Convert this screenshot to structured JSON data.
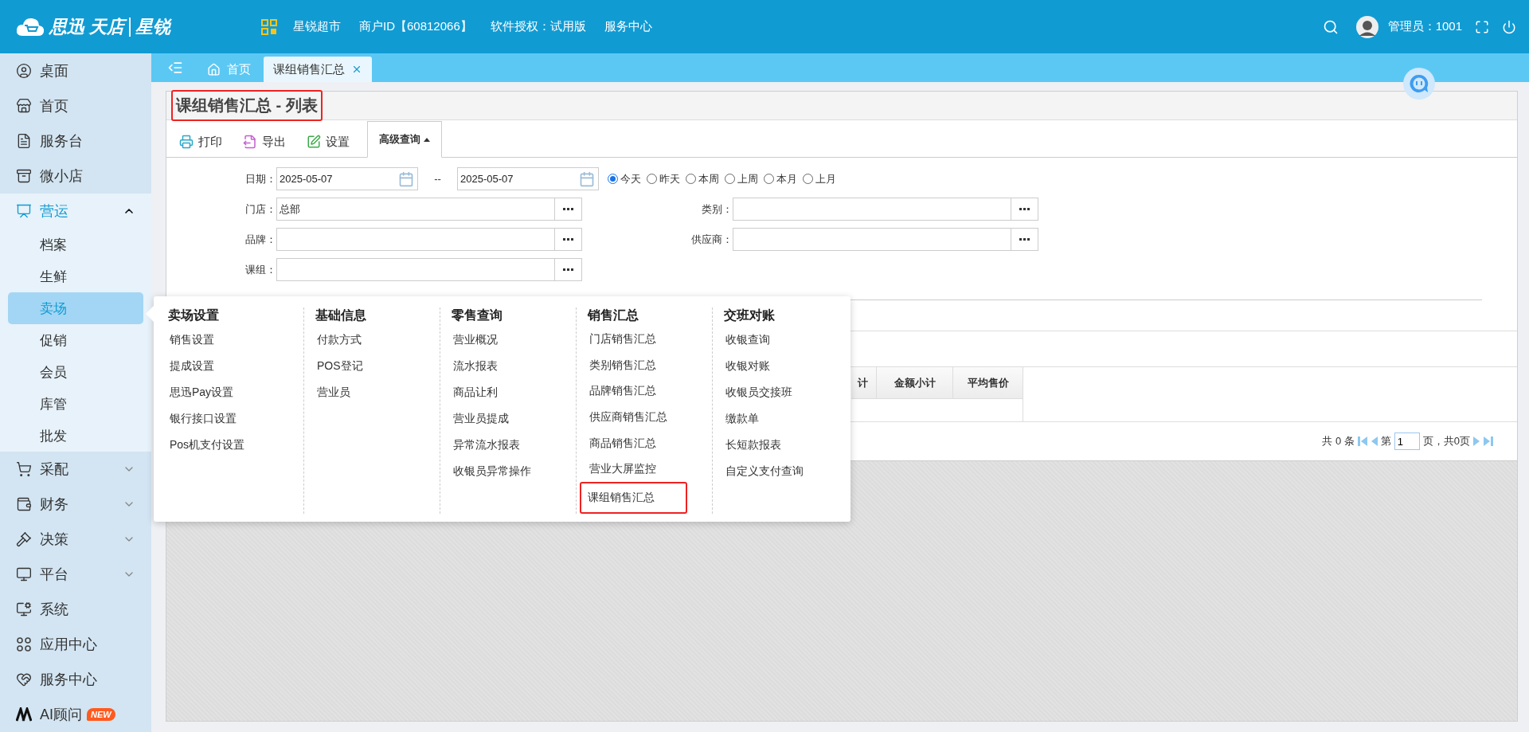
{
  "header": {
    "logo": {
      "brand": "思迅",
      "product": "天店",
      "edition": "星锐"
    },
    "nav": [
      "星锐超市",
      "商户ID【60812066】",
      "软件授权：试用版",
      "服务中心"
    ],
    "user": "管理员：1001"
  },
  "sidebar": {
    "items": [
      {
        "label": "桌面",
        "kind": "plain"
      },
      {
        "label": "首页",
        "kind": "plain"
      },
      {
        "label": "服务台",
        "kind": "plain"
      },
      {
        "label": "微小店",
        "kind": "plain"
      },
      {
        "label": "营运",
        "kind": "group",
        "expanded": true,
        "children": [
          {
            "label": "档案",
            "selected": false
          },
          {
            "label": "生鲜",
            "selected": false
          },
          {
            "label": "卖场",
            "selected": true
          },
          {
            "label": "促销",
            "selected": false
          },
          {
            "label": "会员",
            "selected": false
          },
          {
            "label": "库管",
            "selected": false
          },
          {
            "label": "批发",
            "selected": false
          }
        ]
      },
      {
        "label": "采配",
        "kind": "group",
        "expanded": false
      },
      {
        "label": "财务",
        "kind": "group",
        "expanded": false
      },
      {
        "label": "决策",
        "kind": "group",
        "expanded": false
      },
      {
        "label": "平台",
        "kind": "group",
        "expanded": false
      },
      {
        "label": "系统",
        "kind": "plain"
      },
      {
        "label": "应用中心",
        "kind": "plain"
      },
      {
        "label": "服务中心",
        "kind": "plain"
      },
      {
        "label": "AI顾问",
        "kind": "plain",
        "badge": "NEW"
      }
    ]
  },
  "tabs": [
    {
      "label": "首页",
      "selected": false,
      "closable": false
    },
    {
      "label": "课组销售汇总",
      "selected": true,
      "closable": true
    }
  ],
  "page": {
    "title": "课组销售汇总 - 列表",
    "title_highlighted": true,
    "toolbar": [
      "打印",
      "导出",
      "设置"
    ],
    "query_tab": {
      "label": "高级查询",
      "expanded": true
    },
    "date": {
      "label": "日期：",
      "from": "2025-05-07",
      "separator": "--",
      "to": "2025-05-07"
    },
    "ranges": [
      {
        "label": "今天",
        "selected": true
      },
      {
        "label": "昨天",
        "selected": false
      },
      {
        "label": "本周",
        "selected": false
      },
      {
        "label": "上周",
        "selected": false
      },
      {
        "label": "本月",
        "selected": false
      },
      {
        "label": "上月",
        "selected": false
      }
    ],
    "fields": [
      {
        "label": "门店：",
        "value": "总部"
      },
      {
        "label": "类别："
      },
      {
        "label": "品牌："
      },
      {
        "label": "供应商："
      },
      {
        "label": "课组："
      }
    ],
    "table": {
      "columns": [
        "计",
        "金额小计",
        "平均售价"
      ]
    },
    "pager": {
      "total": "共 0 条",
      "page_label": "第",
      "page": "1",
      "pages": "页，共0页"
    }
  },
  "menu": {
    "columns": [
      {
        "title": "卖场设置",
        "items": [
          {
            "label": "销售设置",
            "highlighted": false
          },
          {
            "label": "提成设置",
            "highlighted": false
          },
          {
            "label": "思迅Pay设置",
            "highlighted": false
          },
          {
            "label": "银行接口设置",
            "highlighted": false
          },
          {
            "label": "Pos机支付设置",
            "highlighted": false
          }
        ]
      },
      {
        "title": "基础信息",
        "items": [
          {
            "label": "付款方式",
            "highlighted": false
          },
          {
            "label": "POS登记",
            "highlighted": false
          },
          {
            "label": "营业员",
            "highlighted": false
          }
        ]
      },
      {
        "title": "零售查询",
        "items": [
          {
            "label": "营业概况",
            "highlighted": false
          },
          {
            "label": "流水报表",
            "highlighted": false
          },
          {
            "label": "商品让利",
            "highlighted": false
          },
          {
            "label": "营业员提成",
            "highlighted": false
          },
          {
            "label": "异常流水报表",
            "highlighted": false
          },
          {
            "label": "收银员异常操作",
            "highlighted": false
          }
        ]
      },
      {
        "title": "销售汇总",
        "items": [
          {
            "label": "门店销售汇总",
            "highlighted": false
          },
          {
            "label": "类别销售汇总",
            "highlighted": false
          },
          {
            "label": "品牌销售汇总",
            "highlighted": false
          },
          {
            "label": "供应商销售汇总",
            "highlighted": false
          },
          {
            "label": "商品销售汇总",
            "highlighted": false
          },
          {
            "label": "营业大屏监控",
            "highlighted": false
          },
          {
            "label": "课组销售汇总",
            "highlighted": true
          }
        ]
      },
      {
        "title": "交班对账",
        "items": [
          {
            "label": "收银查询",
            "highlighted": false
          },
          {
            "label": "收银对账",
            "highlighted": false
          },
          {
            "label": "收银员交接班",
            "highlighted": false
          },
          {
            "label": "缴款单",
            "highlighted": false
          },
          {
            "label": "长短款报表",
            "highlighted": false
          },
          {
            "label": "自定义支付查询",
            "highlighted": false
          }
        ]
      }
    ]
  }
}
